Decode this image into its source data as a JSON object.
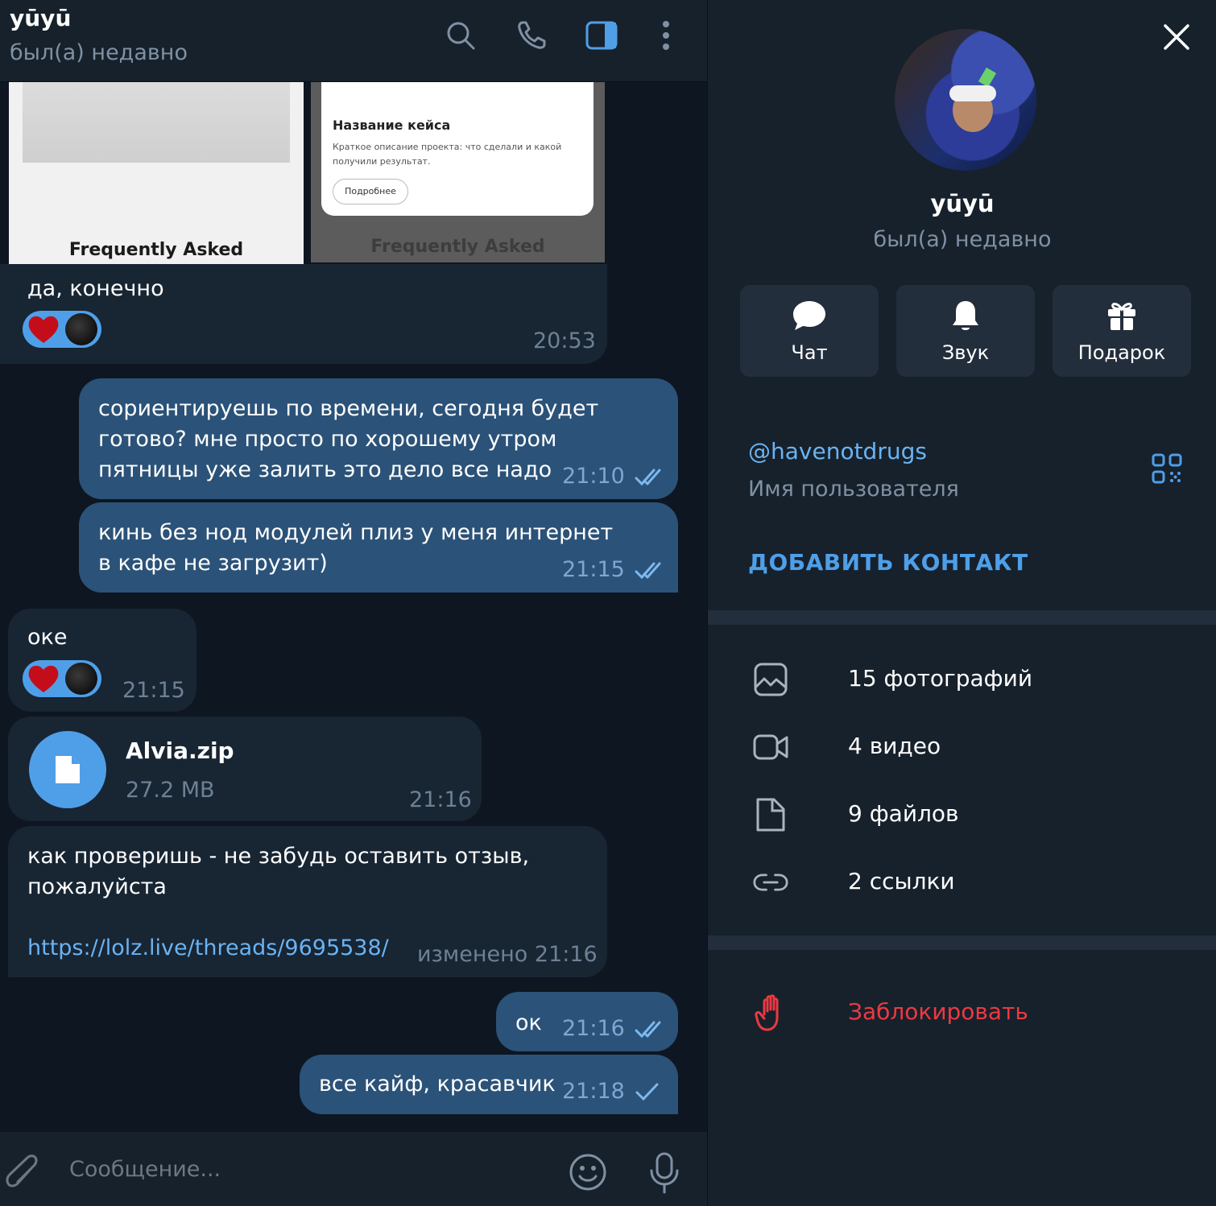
{
  "header": {
    "name": "yūyū",
    "status": "был(а) недавно"
  },
  "photos": {
    "left_caption": "Frequently Asked",
    "right_card_title": "Название кейса",
    "right_card_desc": "Краткое описание проекта: что сделали и какой получили результат.",
    "right_card_button": "Подробнее",
    "right_caption": "Frequently Asked"
  },
  "messages": [
    {
      "dir": "in",
      "text": "да, конечно",
      "time": "20:53"
    },
    {
      "dir": "out",
      "text": "сориентируешь по времени, сегодня будет готово? мне просто по хорошему утром пятницы уже залить это дело все надо",
      "time": "21:10",
      "read": true
    },
    {
      "dir": "out",
      "text": "кинь без нод модулей плиз у меня интернет в кафе не загрузит)",
      "time": "21:15",
      "read": true
    },
    {
      "dir": "in",
      "text": "оке",
      "time": "21:15"
    },
    {
      "dir": "in",
      "file_name": "Alvia.zip",
      "file_size": "27.2 MB",
      "time": "21:16"
    },
    {
      "dir": "in",
      "text": "как проверишь - не забудь оставить отзыв, пожалуйста",
      "link": "https://lolz.live/threads/9695538/",
      "time": "изменено 21:16"
    },
    {
      "dir": "out",
      "text": "ок",
      "time": "21:16",
      "read": true
    },
    {
      "dir": "out",
      "text": "все кайф, красавчик",
      "time": "21:18",
      "read": false
    }
  ],
  "composer": {
    "placeholder": "Сообщение..."
  },
  "profile": {
    "name": "yūyū",
    "status": "был(а) недавно",
    "actions": [
      {
        "label": "Чат",
        "icon": "chat-bubble-icon"
      },
      {
        "label": "Звук",
        "icon": "bell-icon"
      },
      {
        "label": "Подарок",
        "icon": "gift-icon"
      }
    ],
    "username": "@havenotdrugs",
    "username_label": "Имя пользователя",
    "add_contact": "ДОБАВИТЬ КОНТАКТ",
    "media": [
      {
        "label": "15 фотографий",
        "icon": "photo-icon"
      },
      {
        "label": "4 видео",
        "icon": "video-icon"
      },
      {
        "label": "9 файлов",
        "icon": "file-icon"
      },
      {
        "label": "2 ссылки",
        "icon": "link-icon"
      }
    ],
    "block": "Заблокировать"
  },
  "colors": {
    "accent": "#4f9fe8",
    "outgoing_bubble": "#2b5278",
    "incoming_bubble": "#182533",
    "panel": "#17212b",
    "danger": "#ec3942"
  }
}
